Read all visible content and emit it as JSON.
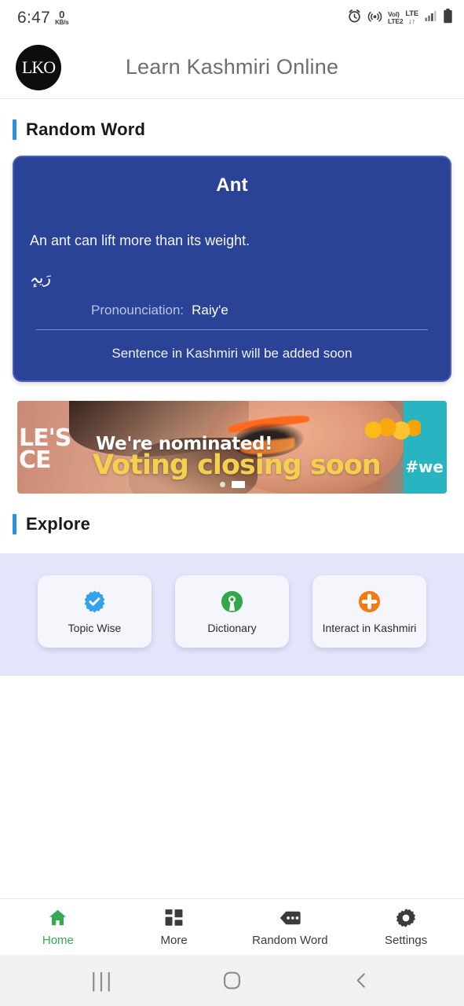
{
  "statusbar": {
    "time": "6:47",
    "net_speed_value": "0",
    "net_speed_unit": "KB/s",
    "alarm_icon": "alarm-icon",
    "hotspot_icon": "hotspot-icon",
    "volte_line1": "Vol)",
    "volte_line2": "LTE2",
    "lte_label": "LTE",
    "lte_arrows": "↓↑",
    "signal_icon": "signal-bars-icon",
    "battery_icon": "battery-icon"
  },
  "appbar": {
    "logo_text": "LKO",
    "title": "Learn Kashmiri Online"
  },
  "sections": {
    "random_word_title": "Random Word",
    "explore_title": "Explore"
  },
  "word_card": {
    "word": "Ant",
    "meaning": "An ant can lift more than its weight.",
    "kashmiri_script": "رَیہٕ",
    "pronunciation_label": "Pronounciation:",
    "pronunciation_value": "Raiy'e",
    "sentence_note": "Sentence in Kashmiri will be added soon",
    "bg_color": "#2b4397"
  },
  "banner": {
    "ghost_line1": "LE'S",
    "ghost_line2": "CE",
    "headline": "We're nominated!",
    "subheadline": "Voting closing soon",
    "hashtag": "#we",
    "dots": [
      {
        "active": false
      },
      {
        "active": true
      }
    ]
  },
  "explore": {
    "cards": [
      {
        "label": "Topic Wise",
        "icon": "verified-badge-icon",
        "color": "#35a0ec"
      },
      {
        "label": "Dictionary",
        "icon": "open-source-keyhole-icon",
        "color": "#34a749"
      },
      {
        "label": "Interact in Kashmiri",
        "icon": "plus-circle-icon",
        "color": "#f07c13"
      }
    ],
    "panel_bg": "#e3e5fb"
  },
  "bottom_nav": {
    "active_color": "#35a853",
    "items": [
      {
        "label": "Home",
        "icon": "home-icon",
        "active": true
      },
      {
        "label": "More",
        "icon": "grid-dashboard-icon",
        "active": false
      },
      {
        "label": "Random Word",
        "icon": "tag-dots-icon",
        "active": false
      },
      {
        "label": "Settings",
        "icon": "gear-icon",
        "active": false
      }
    ]
  },
  "system_nav": {
    "recents": "|||",
    "home": "home-square-icon",
    "back": "back-chevron-icon"
  }
}
